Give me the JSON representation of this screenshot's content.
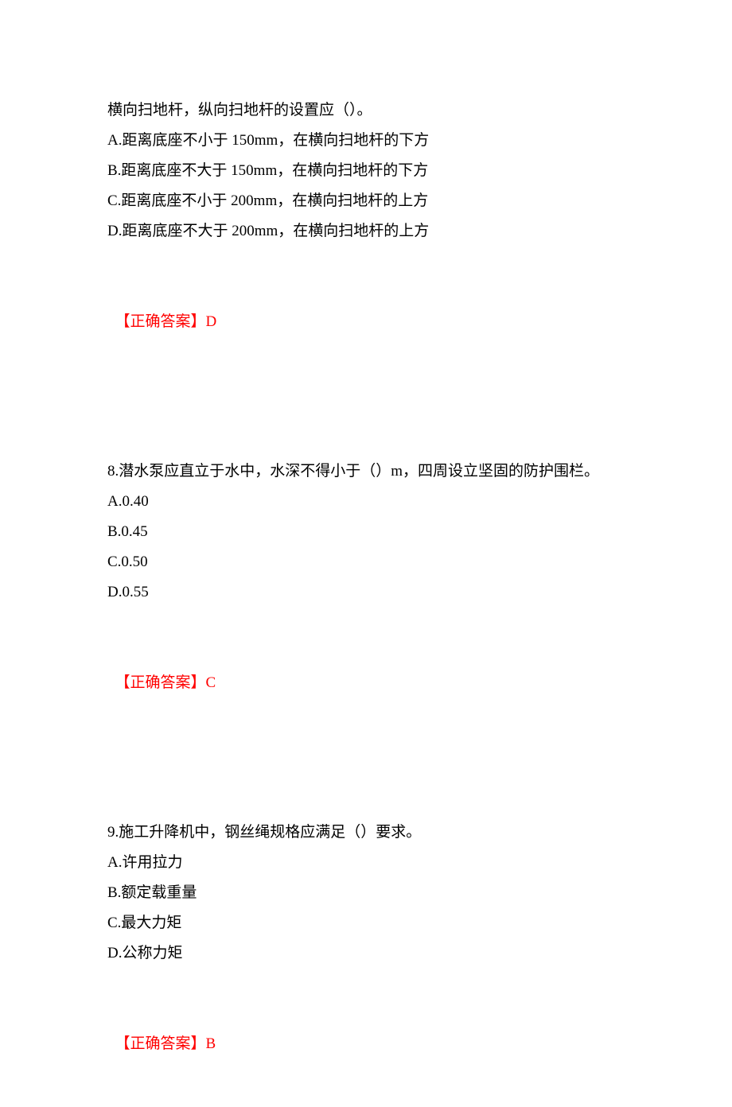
{
  "q7": {
    "stem": "横向扫地杆，纵向扫地杆的设置应（）。",
    "optA": "A.距离底座不小于 150mm，在横向扫地杆的下方",
    "optB": "B.距离底座不大于 150mm，在横向扫地杆的下方",
    "optC": "C.距离底座不小于 200mm，在横向扫地杆的上方",
    "optD": "D.距离底座不大于 200mm，在横向扫地杆的上方",
    "answer_label": "【正确答案】",
    "answer_value": "D"
  },
  "q8": {
    "stem": "8.潜水泵应直立于水中，水深不得小于（）m，四周设立坚固的防护围栏。",
    "optA": "A.0.40",
    "optB": "B.0.45",
    "optC": "C.0.50",
    "optD": "D.0.55",
    "answer_label": "【正确答案】",
    "answer_value": "C"
  },
  "q9": {
    "stem": "9.施工升降机中，钢丝绳规格应满足（）要求。",
    "optA": "A.许用拉力",
    "optB": "B.额定载重量",
    "optC": "C.最大力矩",
    "optD": "D.公称力矩",
    "answer_label": "【正确答案】",
    "answer_value": "B"
  }
}
